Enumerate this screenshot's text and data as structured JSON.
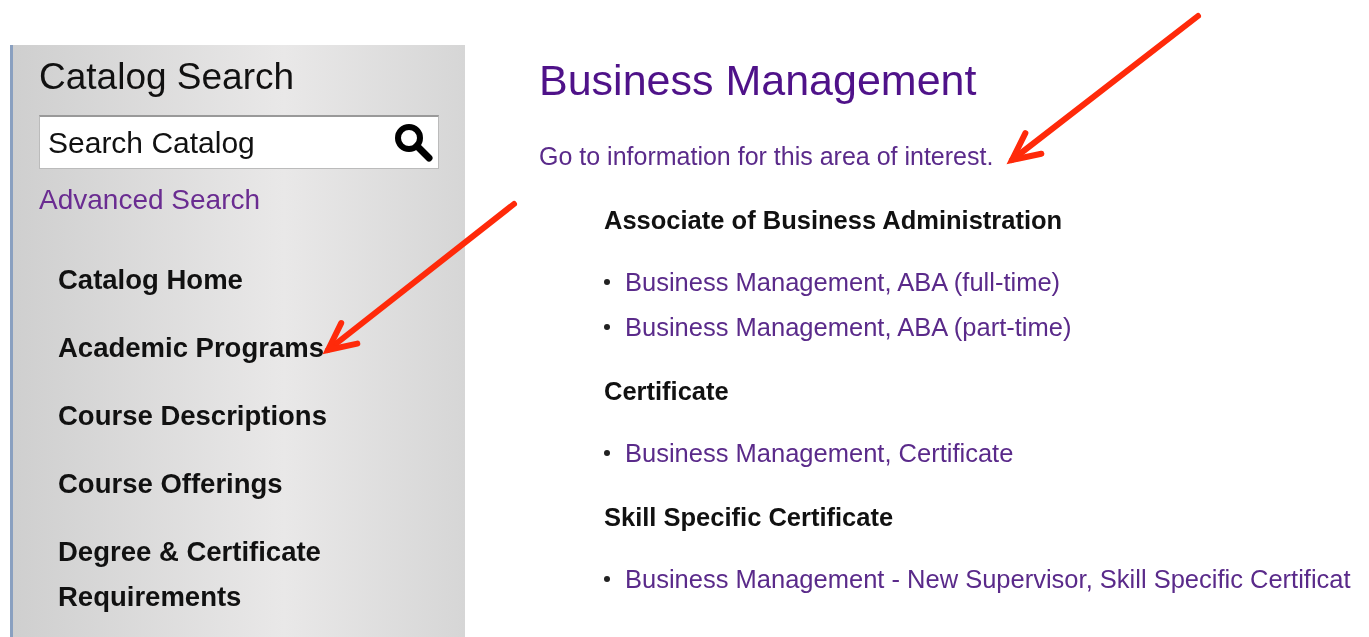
{
  "sidebar": {
    "title": "Catalog Search",
    "search": {
      "placeholder": "Search Catalog"
    },
    "advanced_link": "Advanced Search",
    "nav": [
      {
        "label": "Catalog Home"
      },
      {
        "label": "Academic Programs"
      },
      {
        "label": "Course Descriptions"
      },
      {
        "label": "Course Offerings"
      },
      {
        "label": "Degree & Certificate Requirements"
      }
    ]
  },
  "main": {
    "title": "Business Management",
    "info_link": "Go to information for this area of interest.",
    "sections": [
      {
        "heading": "Associate of Business Administration",
        "links": [
          "Business Management, ABA (full-time)",
          "Business Management, ABA (part-time)"
        ]
      },
      {
        "heading": "Certificate",
        "links": [
          "Business Management, Certificate"
        ]
      },
      {
        "heading": "Skill Specific Certificate",
        "links": [
          "Business Management - New Supervisor, Skill Specific Certificat"
        ]
      }
    ]
  }
}
